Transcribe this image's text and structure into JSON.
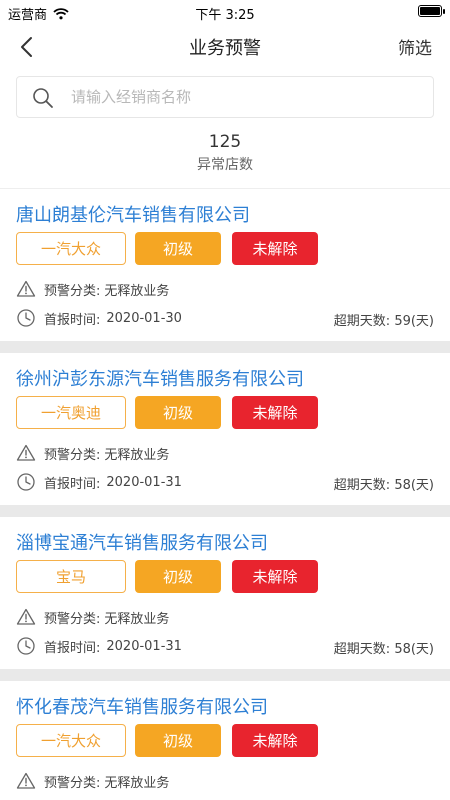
{
  "status_bar": {
    "carrier": "运营商",
    "time": "下午 3:25"
  },
  "nav": {
    "title": "业务预警",
    "filter_label": "筛选"
  },
  "search": {
    "placeholder": "请输入经销商名称"
  },
  "summary": {
    "count": "125",
    "label": "异常店数"
  },
  "cards": [
    {
      "name": "唐山朗基伦汽车销售有限公司",
      "brand": "一汽大众",
      "level": "初级",
      "status": "未解除",
      "category_label": "预警分类:",
      "category_value": "无释放业务",
      "date_label": "首报时间:",
      "date_value": "2020-01-30",
      "overdue_label": "超期天数:",
      "overdue_value": "59(天)"
    },
    {
      "name": "徐州沪彭东源汽车销售服务有限公司",
      "brand": "一汽奥迪",
      "level": "初级",
      "status": "未解除",
      "category_label": "预警分类:",
      "category_value": "无释放业务",
      "date_label": "首报时间:",
      "date_value": "2020-01-31",
      "overdue_label": "超期天数:",
      "overdue_value": "58(天)"
    },
    {
      "name": "淄博宝通汽车销售服务有限公司",
      "brand": "宝马",
      "level": "初级",
      "status": "未解除",
      "category_label": "预警分类:",
      "category_value": "无释放业务",
      "date_label": "首报时间:",
      "date_value": "2020-01-31",
      "overdue_label": "超期天数:",
      "overdue_value": "58(天)"
    },
    {
      "name": "怀化春茂汽车销售服务有限公司",
      "brand": "一汽大众",
      "level": "初级",
      "status": "未解除",
      "category_label": "预警分类:",
      "category_value": "无释放业务",
      "date_label": "",
      "date_value": "",
      "overdue_label": "",
      "overdue_value": ""
    }
  ],
  "colors": {
    "link_blue": "#2d7fd4",
    "level_orange": "#f5a623",
    "status_red": "#e8242e",
    "brand_border": "#f5b04a"
  },
  "icons": {
    "back": "chevron-left-icon",
    "search": "search-icon",
    "warning": "warning-triangle-icon",
    "clock": "clock-icon",
    "wifi": "wifi-icon",
    "battery": "battery-icon"
  }
}
